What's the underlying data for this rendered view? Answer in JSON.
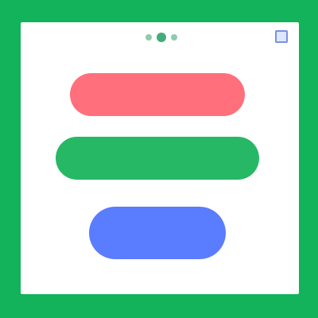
{
  "colors": {
    "frame": "#12b35a",
    "panel": "#ffffff",
    "red_button": "#ff6f7c",
    "green_button": "#27b866",
    "blue_button": "#5a7cff",
    "top_indicator": "#2fa36a",
    "corner_icon": "#7a8fe8"
  },
  "header": {
    "indicator_icon": "page-dots-icon",
    "corner_icon": "window-icon"
  },
  "buttons": [
    {
      "label": "",
      "color": "red"
    },
    {
      "label": "",
      "color": "green"
    },
    {
      "label": "",
      "color": "blue"
    }
  ]
}
